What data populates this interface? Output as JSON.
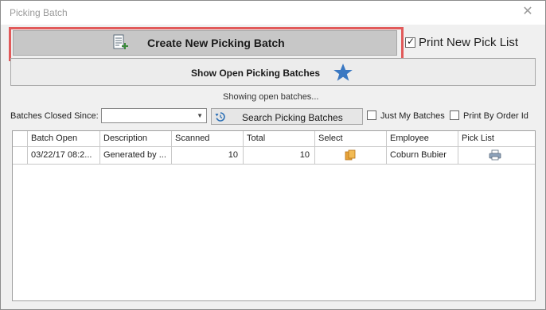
{
  "window": {
    "title": "Picking Batch",
    "close_glyph": "✕"
  },
  "create_button": {
    "label": "Create New Picking Batch",
    "icon": "document-add-icon"
  },
  "print_new_pick_list": {
    "label": "Print New Pick List",
    "checked": true
  },
  "show_open_button": {
    "label": "Show Open Picking Batches",
    "icon": "star-icon"
  },
  "status_text": "Showing open batches...",
  "filters": {
    "closed_since_label": "Batches Closed Since:",
    "closed_since_value": "",
    "search_button_label": "Search Picking Batches",
    "just_my_batches_label": "Just My Batches",
    "just_my_batches_checked": false,
    "print_by_order_label": "Print By Order Id",
    "print_by_order_checked": false
  },
  "table": {
    "columns": [
      "Batch Open",
      "Description",
      "Scanned",
      "Total",
      "Select",
      "Employee",
      "Pick List"
    ],
    "rows": [
      {
        "batch_open": "03/22/17 08:2...",
        "description": "Generated by ...",
        "scanned": "10",
        "total": "10",
        "select_icon": "copy-icon",
        "employee": "Coburn Bubier",
        "pick_list_icon": "printer-icon"
      }
    ]
  },
  "colors": {
    "highlight": "#e15a5a",
    "star": "#3a78c2",
    "select_icon": "#e8a33a"
  }
}
